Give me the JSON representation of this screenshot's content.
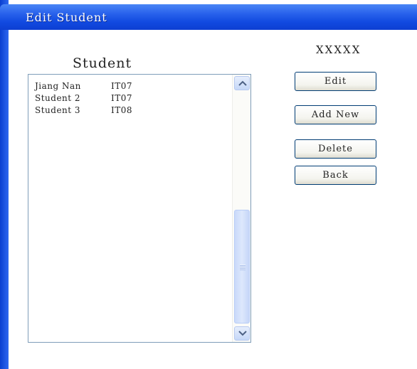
{
  "window": {
    "title": "Edit Student"
  },
  "heading": "Student",
  "name_label": "XXXXX",
  "students": [
    {
      "name": "Jiang Nan",
      "class": "IT07"
    },
    {
      "name": "Student 2",
      "class": "IT07"
    },
    {
      "name": "Student 3",
      "class": "IT08"
    }
  ],
  "buttons": {
    "edit": "Edit",
    "add_new": "Add New",
    "delete": "Delete",
    "back": "Back"
  },
  "scrollbar": {
    "up_icon": "chevron-up-icon",
    "down_icon": "chevron-down-icon",
    "position_fraction": 0.55
  },
  "colors": {
    "titlebar": "#2a63ec",
    "button_border": "#003c74",
    "listbox_border": "#7f9db9"
  }
}
